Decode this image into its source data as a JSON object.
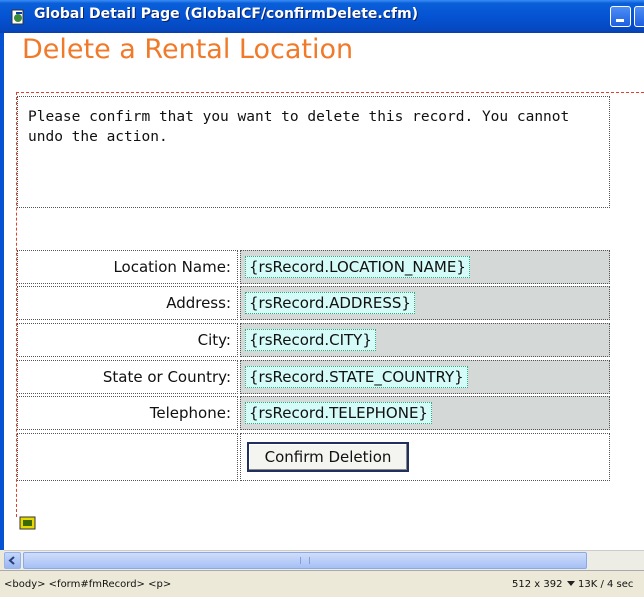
{
  "window": {
    "title": "Global Detail Page (GlobalCF/confirmDelete.cfm)"
  },
  "page": {
    "heading": "Delete a Rental Location",
    "intro": "Please confirm that you want to delete this record. You cannot undo the action.",
    "rows": [
      {
        "label": "Location Name:",
        "value": "{rsRecord.LOCATION_NAME}"
      },
      {
        "label": "Address:",
        "value": "{rsRecord.ADDRESS}"
      },
      {
        "label": "City:",
        "value": "{rsRecord.CITY}"
      },
      {
        "label": "State or Country:",
        "value": "{rsRecord.STATE_COUNTRY}"
      },
      {
        "label": "Telephone:",
        "value": "{rsRecord.TELEPHONE}"
      }
    ],
    "confirm_button": "Confirm Deletion"
  },
  "statusbar": {
    "tag_path": "<body> <form#fmRecord> <p>",
    "dimensions": "512 x 392",
    "size_time": "13K / 4 sec"
  },
  "colors": {
    "title_bar": "#0553d3",
    "heading": "#f07a2a",
    "dynamic_value_bg": "#d4fbf7",
    "value_cell_bg": "#d4d8d6"
  },
  "icons": [
    "document-icon",
    "minimize-icon",
    "maximize-icon",
    "form-marker-icon",
    "scroll-left-icon",
    "dropdown-icon"
  ]
}
